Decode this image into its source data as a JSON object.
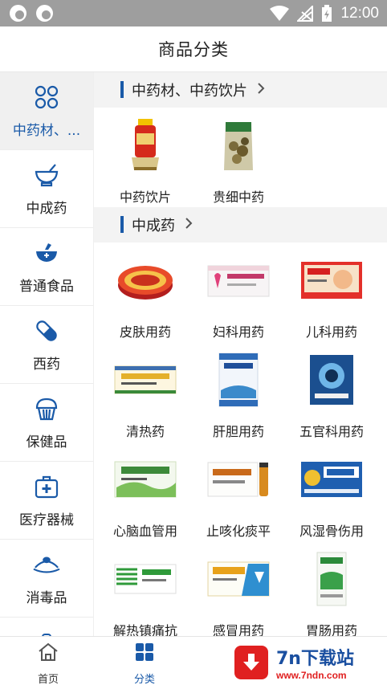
{
  "status_bar": {
    "time": "12:00",
    "icons": [
      "app-icon",
      "app-icon",
      "wifi-icon",
      "no-signal-icon",
      "battery-charging-icon"
    ]
  },
  "header": {
    "title": "商品分类"
  },
  "sidebar": {
    "items": [
      {
        "label": "中药材、...",
        "icon": "four-petal-icon",
        "active": true
      },
      {
        "label": "中成药",
        "icon": "mortar-icon",
        "active": false
      },
      {
        "label": "普通食品",
        "icon": "bowl-icon",
        "active": false
      },
      {
        "label": "西药",
        "icon": "capsule-icon",
        "active": false
      },
      {
        "label": "保健品",
        "icon": "cupcake-icon",
        "active": false
      },
      {
        "label": "医疗器械",
        "icon": "medical-kit-icon",
        "active": false
      },
      {
        "label": "消毒品",
        "icon": "dish-icon",
        "active": false
      }
    ]
  },
  "sections": [
    {
      "title": "中药材、中药饮片",
      "items": [
        {
          "label": "中药饮片"
        },
        {
          "label": "贵细中药"
        }
      ]
    },
    {
      "title": "中成药",
      "items": [
        {
          "label": "皮肤用药"
        },
        {
          "label": "妇科用药"
        },
        {
          "label": "儿科用药"
        },
        {
          "label": "清热药"
        },
        {
          "label": "肝胆用药"
        },
        {
          "label": "五官科用药"
        },
        {
          "label": "心脑血管用"
        },
        {
          "label": "止咳化痰平"
        },
        {
          "label": "风湿骨伤用"
        },
        {
          "label": "解热镇痛抗"
        },
        {
          "label": "感冒用药"
        },
        {
          "label": "胃肠用药"
        }
      ]
    }
  ],
  "bottom_nav": {
    "tabs": [
      {
        "label": "首页",
        "icon": "home-icon",
        "active": false
      },
      {
        "label": "分类",
        "icon": "grid-icon",
        "active": true
      }
    ]
  },
  "watermark": {
    "title": "7n下载站",
    "url": "www.7ndn.com"
  },
  "colors": {
    "accent": "#1a5aa8",
    "status_bar": "#9e9e9e",
    "section_bg": "#f3f3f3",
    "active_bg": "#f0f0f0",
    "watermark_red": "#e02020"
  }
}
